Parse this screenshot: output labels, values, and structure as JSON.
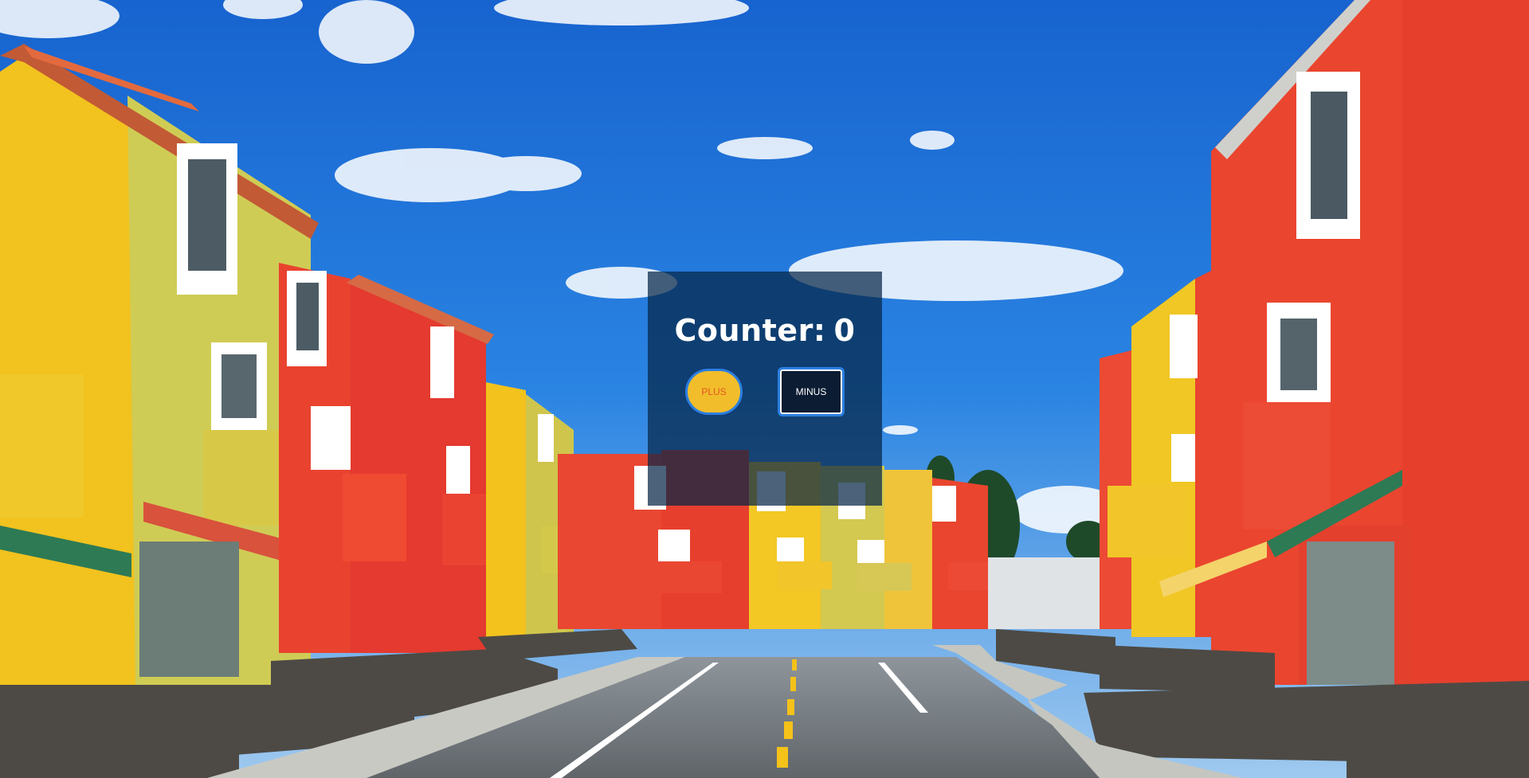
{
  "counter": {
    "label": "Counter:",
    "value": "0"
  },
  "buttons": {
    "plus_label": "PLUS",
    "minus_label": "MINUS"
  },
  "colors": {
    "sky": "#1f74d9",
    "card_overlay": "#062646",
    "plus_fill": "#f2bd2b",
    "plus_text": "#e0571e",
    "minus_fill": "#0b1c33",
    "button_border": "#2b7fe0"
  }
}
